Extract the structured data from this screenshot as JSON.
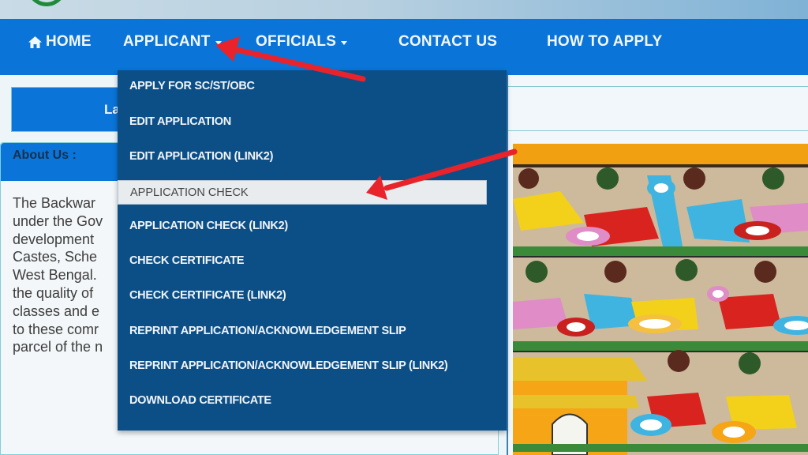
{
  "navbar": {
    "items": [
      {
        "label": "HOME",
        "icon": "home-icon",
        "has_dropdown": false
      },
      {
        "label": "APPLICANT",
        "icon": null,
        "has_dropdown": true,
        "open": true
      },
      {
        "label": "OFFICIALS",
        "icon": null,
        "has_dropdown": true
      },
      {
        "label": "CONTACT US",
        "icon": null,
        "has_dropdown": false
      },
      {
        "label": "HOW TO APPLY",
        "icon": null,
        "has_dropdown": false
      }
    ]
  },
  "applicant_menu": {
    "items": [
      {
        "label": "APPLY FOR SC/ST/OBC"
      },
      {
        "label": "EDIT APPLICATION"
      },
      {
        "label": "EDIT APPLICATION (LINK2)"
      },
      {
        "label": "APPLICATION CHECK",
        "highlighted": true
      },
      {
        "label": "APPLICATION CHECK (LINK2)"
      },
      {
        "label": "CHECK CERTIFICATE"
      },
      {
        "label": "CHECK CERTIFICATE (LINK2)"
      },
      {
        "label": "REPRINT APPLICATION/ACKNOWLEDGEMENT SLIP"
      },
      {
        "label": "REPRINT APPLICATION/ACKNOWLEDGEMENT SLIP (LINK2)"
      },
      {
        "label": "DOWNLOAD CERTIFICATE"
      }
    ]
  },
  "latest": {
    "label": "Late"
  },
  "about": {
    "title": "About Us :",
    "lines": [
      "The  Backwar",
      "under the Gov",
      "development",
      "Castes,  Sche",
      "West Bengal.",
      "the quality of",
      "classes and e",
      "to these comr",
      "parcel of the n"
    ]
  },
  "annotations": {
    "arrow_color": "#e8232b",
    "arrows": [
      {
        "points_to": "APPLICANT menu"
      },
      {
        "points_to": "APPLICATION CHECK item"
      }
    ]
  },
  "colors": {
    "navbar": "#0a74d8",
    "dropdown": "#0c4f87",
    "highlight": "#e8ecef"
  }
}
